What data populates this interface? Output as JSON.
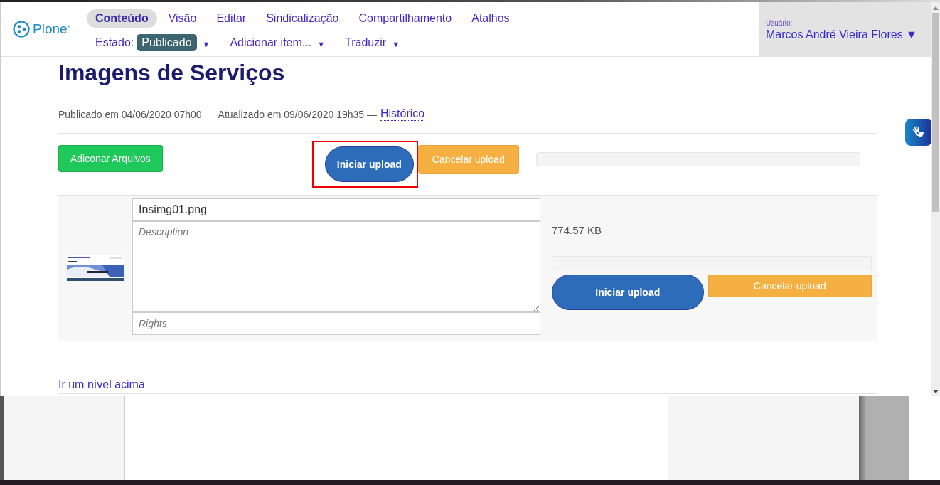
{
  "header": {
    "logo": "Plone$^{®}$",
    "tabs": [
      {
        "label": "Conteúdo",
        "selected": true
      },
      {
        "label": "Visão",
        "selected": false
      },
      {
        "label": "Editar",
        "selected": false
      },
      {
        "label": "Sindicalização",
        "selected": false
      },
      {
        "label": "Compartilhamento",
        "selected": false
      },
      {
        "label": "Atalhos",
        "selected": false
      }
    ],
    "state_label": "Estado:",
    "state": "Publicado",
    "state_arrow": "▼",
    "menus": [
      {
        "label": "Adicionar item...",
        "arrow": "▼"
      },
      {
        "label": "Traduzir",
        "arrow": "▼"
      }
    ],
    "user_label": "Usuário:",
    "user_name": "Marcos André Vieira Flores",
    "user_arrow": "▼"
  },
  "title": "Imagens de Serviços",
  "byline": {
    "published": "Publicado em 04/06/2020 07h00",
    "updated": "Atualizado em 09/06/2020 19h35 —",
    "history_link": "Histórico"
  },
  "toolbar": {
    "buttons": [
      {
        "label": "Adiconar Arquivos",
        "kind": "add",
        "highlighted": false
      },
      {
        "label": "Iniciar upload",
        "kind": "start",
        "highlighted": true
      },
      {
        "label": "Cancelar upload",
        "kind": "cancel",
        "highlighted": false
      }
    ],
    "progress": {
      "level": 0
    }
  },
  "files": [
    {
      "name_value": "Insimg01.png",
      "description_placeholder": "Description",
      "rights_placeholder": "Rights",
      "size": "774.57 KB",
      "progress": {
        "level": 0
      },
      "buttons": [
        {
          "label": "Iniciar upload",
          "kind": "start"
        },
        {
          "label": "Cancelar upload",
          "kind": "cancel"
        }
      ]
    }
  ],
  "up_link": "Ir um nível acima"
}
